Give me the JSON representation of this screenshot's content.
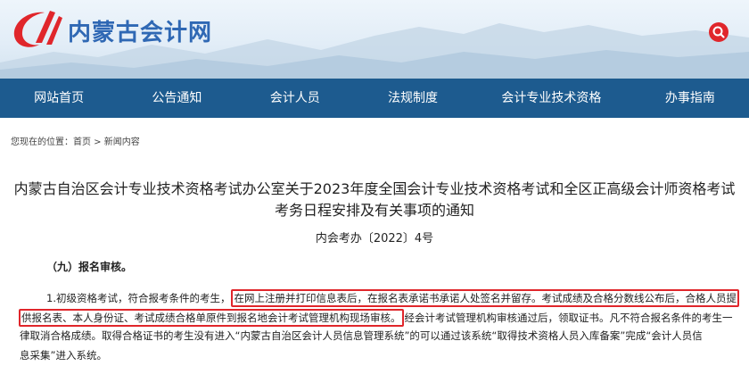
{
  "header": {
    "site_name": "内蒙古会计网",
    "logo_icon": "swoosh-logo-icon",
    "search_icon": "search-icon",
    "brand_color": "#2f68b4",
    "logo_color": "#e0262b"
  },
  "nav": {
    "background": "#1d5b8f",
    "items": [
      "网站首页",
      "公告通知",
      "会计人员",
      "法规制度",
      "会计专业技术资格",
      "办事指南"
    ]
  },
  "breadcrumb": "您现在的位置：首页 > 新闻内容",
  "article": {
    "title_line1": "内蒙古自治区会计专业技术资格考试办公室关于2023年度全国会计专业技术资格考试和全区正高级会计师资格考试",
    "title_line2": "考务日程安排及有关事项的通知",
    "doc_number": "内会考办〔2022〕4号",
    "section_heading": "（九）报名审核。",
    "p1_pre": "1.初级资格考试，符合报考条件的考生，",
    "p1_highlight": "在网上注册并打印信息表后，在报名表承诺书承诺人处签名并留存。考试成绩及合格分数线公布后，合格人员提",
    "p2_highlight": "供报名表、本人身份证、考试成绩合格单原件到报名地会计考试管理机构现场审核。",
    "p2_post": "经会计考试管理机构审核通过后，领取证书。凡不符合报名条件的考生一",
    "p3": "律取消合格成绩。取得合格证书的考生没有进入“内蒙古自治区会计人员信息管理系统”的可以通过该系统“取得技术资格人员入库备案”完成“会计人员信",
    "p4": "息采集”进入系统。",
    "highlight_color": "#e0262b"
  }
}
